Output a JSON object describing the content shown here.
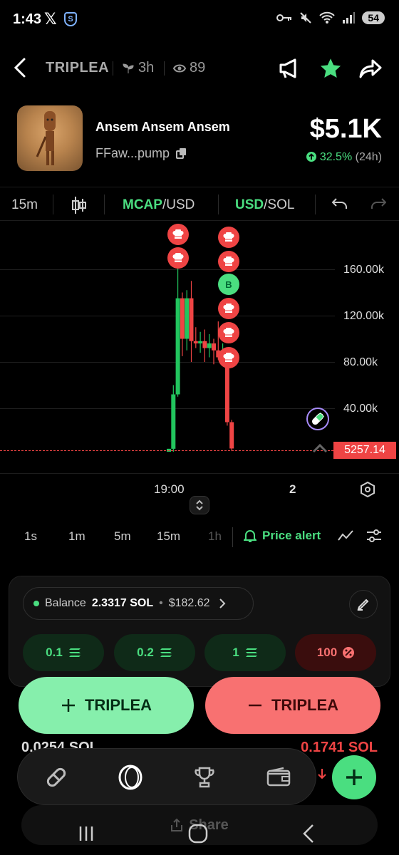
{
  "status": {
    "time": "1:43",
    "x_label": "𝕏",
    "shield_label": "S",
    "battery": "54",
    "signal": "5"
  },
  "header": {
    "ticker": "TRIPLEA",
    "age": "3h",
    "views": "89"
  },
  "token": {
    "name": "Ansem Ansem Ansem",
    "address": "FFaw...pump",
    "price": "$5.1K",
    "change_pct": "32.5%",
    "change_period": "(24h)"
  },
  "chart_toolbar": {
    "interval": "15m",
    "mcap": "MCAP",
    "usd1": "/USD",
    "usd2": "USD",
    "sol": "/SOL"
  },
  "chart_data": {
    "type": "candlestick",
    "y_ticks": [
      "160.00k",
      "120.00k",
      "80.00k",
      "40.00k"
    ],
    "current_price_label": "5257.14",
    "x_ticks": [
      "19:00",
      "2"
    ],
    "candles": [
      {
        "o": 0,
        "h": 5000,
        "l": 0,
        "c": 5000
      },
      {
        "o": 5000,
        "h": 60000,
        "l": 0,
        "c": 52000
      },
      {
        "o": 52000,
        "h": 168000,
        "l": 50000,
        "c": 135000
      },
      {
        "o": 135000,
        "h": 140000,
        "l": 85000,
        "c": 100000
      },
      {
        "o": 100000,
        "h": 142000,
        "l": 90000,
        "c": 135000
      },
      {
        "o": 135000,
        "h": 150000,
        "l": 80000,
        "c": 98000
      },
      {
        "o": 98000,
        "h": 110000,
        "l": 92000,
        "c": 96000
      },
      {
        "o": 96000,
        "h": 106000,
        "l": 88000,
        "c": 98000
      },
      {
        "o": 98000,
        "h": 108000,
        "l": 80000,
        "c": 92000
      },
      {
        "o": 92000,
        "h": 104000,
        "l": 84000,
        "c": 96000
      },
      {
        "o": 96000,
        "h": 100000,
        "l": 78000,
        "c": 90000
      },
      {
        "o": 90000,
        "h": 115000,
        "l": 82000,
        "c": 84000
      },
      {
        "o": 84000,
        "h": 96000,
        "l": 78000,
        "c": 90000
      },
      {
        "o": 90000,
        "h": 92000,
        "l": 25000,
        "c": 28000
      },
      {
        "o": 28000,
        "h": 30000,
        "l": 3000,
        "c": 5257
      }
    ],
    "markers": [
      {
        "label": "",
        "candle": 2,
        "y": 190000
      },
      {
        "label": "",
        "candle": 2,
        "y": 170000
      },
      {
        "label": "",
        "candle": 13,
        "y": 188000
      },
      {
        "label": "",
        "candle": 13,
        "y": 167000
      },
      {
        "label": "B",
        "candle": 13,
        "y": 147000
      },
      {
        "label": "",
        "candle": 13,
        "y": 126000
      },
      {
        "label": "",
        "candle": 13,
        "y": 105000
      },
      {
        "label": "",
        "candle": 13,
        "y": 84000
      }
    ]
  },
  "timeframes": [
    "1s",
    "1m",
    "5m",
    "15m",
    "1h"
  ],
  "price_alert": "Price alert",
  "balance": {
    "label": "Balance",
    "sol": "2.3317 SOL",
    "usd": "$182.62"
  },
  "amounts": [
    "0.1",
    "0.2",
    "1",
    "100"
  ],
  "buy_label": "TRIPLEA",
  "sell_label": "TRIPLEA",
  "under_left": "0.0254 SOL",
  "under_right": "0.1741 SOL",
  "share_label": "Share",
  "colors": {
    "accent": "#4ade80",
    "sell": "#f87171",
    "buy_bg": "#86efac"
  }
}
